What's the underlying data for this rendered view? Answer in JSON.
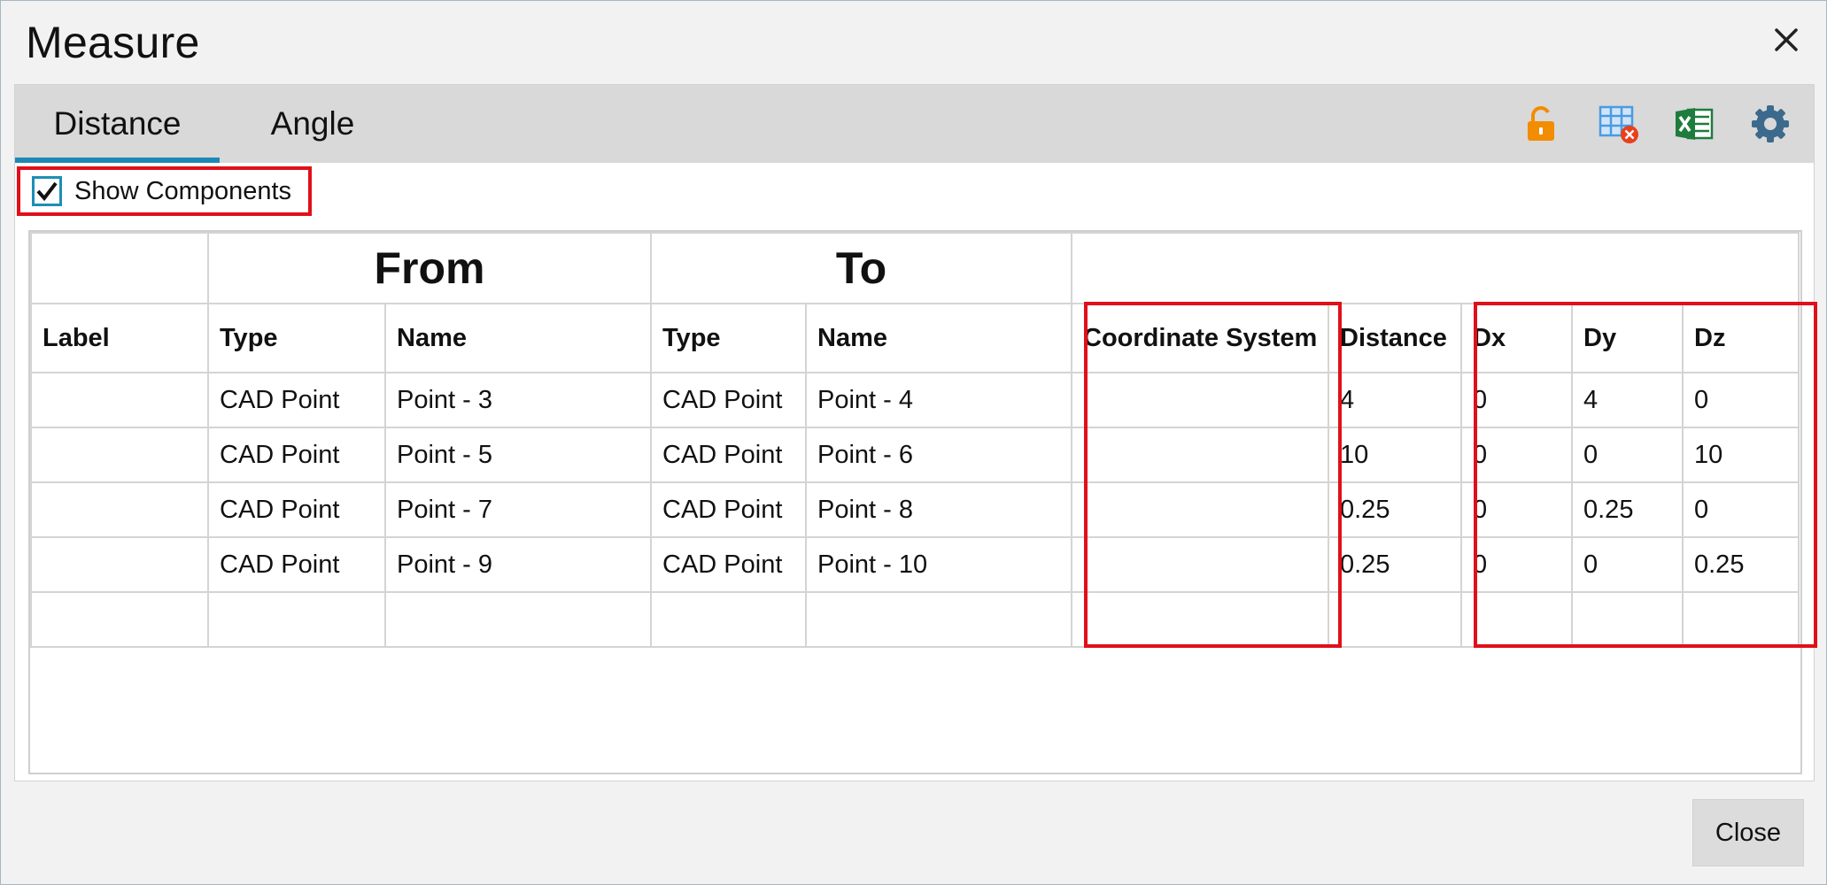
{
  "window": {
    "title": "Measure",
    "close_icon": "close-x-icon"
  },
  "tabs": [
    {
      "label": "Distance",
      "active": true
    },
    {
      "label": "Angle",
      "active": false
    }
  ],
  "toolbar": {
    "icons": [
      "unlock-icon",
      "table-delete-icon",
      "excel-icon",
      "gear-icon"
    ],
    "colors": {
      "unlock": "#f28c00",
      "table_delete": "#4b9be0",
      "table_delete_badge": "#e8401c",
      "excel": "#1e7c3c",
      "gear": "#3c6a8c"
    }
  },
  "show_components": {
    "label": "Show Components",
    "checked": true
  },
  "table": {
    "group_headers": {
      "from": "From",
      "to": "To"
    },
    "columns": [
      "Label",
      "Type",
      "Name",
      "Type",
      "Name",
      "Coordinate System",
      "Distance",
      "Dx",
      "Dy",
      "Dz"
    ],
    "rows": [
      [
        "",
        "CAD Point",
        "Point - 3",
        "CAD Point",
        "Point - 4",
        "",
        "4",
        "0",
        "4",
        "0"
      ],
      [
        "",
        "CAD Point",
        "Point - 5",
        "CAD Point",
        "Point - 6",
        "",
        "10",
        "0",
        "0",
        "10"
      ],
      [
        "",
        "CAD Point",
        "Point - 7",
        "CAD Point",
        "Point - 8",
        "",
        "0.25",
        "0",
        "0.25",
        "0"
      ],
      [
        "",
        "CAD Point",
        "Point - 9",
        "CAD Point",
        "Point - 10",
        "",
        "0.25",
        "0",
        "0",
        "0.25"
      ]
    ]
  },
  "highlight_color": "#e0101a",
  "footer": {
    "close_label": "Close"
  }
}
